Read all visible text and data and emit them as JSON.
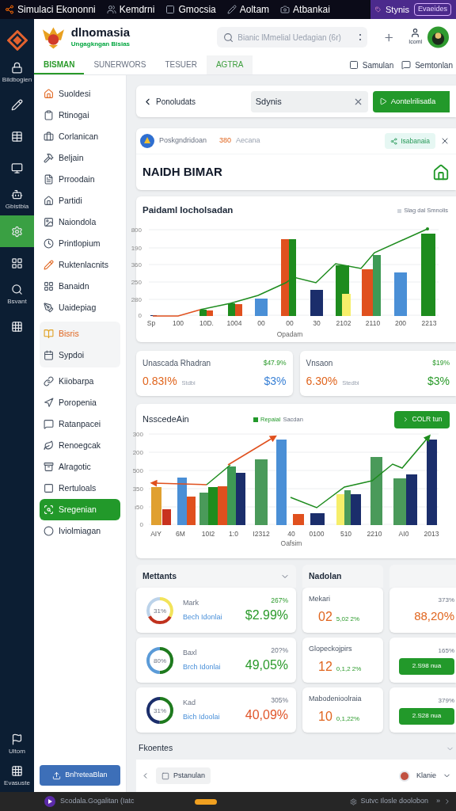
{
  "top_bar": {
    "items": [
      "Simulaci Ekononni",
      "Kemdrni",
      "Gmocsia",
      "Aoltam",
      "Atbankai"
    ],
    "user": "Stynis",
    "button": "Evaeides"
  },
  "rail": {
    "items": [
      {
        "label": "Bildbogien",
        "selected": false
      },
      {
        "selected": false
      },
      {
        "selected": false
      },
      {
        "selected": false
      },
      {
        "label": "Gbistbia",
        "selected": false
      },
      {
        "selected": true
      },
      {
        "selected": false
      },
      {
        "label": "Bsvant",
        "selected": false
      },
      {
        "selected": false
      }
    ],
    "bottom": [
      "Ultom",
      "Evasuste"
    ]
  },
  "header": {
    "title": "dlnomasia",
    "subtitle": "Ungagkngan Bisias",
    "search": {
      "placeholder": "Bianic lMmelial Uedagian (6r)"
    },
    "account": "Icoml"
  },
  "tabs": [
    {
      "label": "BISMAN",
      "selected": true,
      "hover": false
    },
    {
      "label": "SUNERWORS",
      "selected": false,
      "hover": false
    },
    {
      "label": "TESUER",
      "selected": false,
      "hover": false
    },
    {
      "label": "AGTRA",
      "selected": false,
      "hover": true
    }
  ],
  "tab_actions": [
    "Samulan",
    "Semtonlan"
  ],
  "nav": {
    "items": [
      {
        "kind": "item",
        "label": "Suoldesi",
        "selected": false
      },
      {
        "kind": "item",
        "label": "Rtinogai",
        "selected": false
      },
      {
        "kind": "item",
        "label": "Corlanican",
        "selected": false
      },
      {
        "kind": "item",
        "label": "Beljain",
        "selected": false
      },
      {
        "kind": "item",
        "label": "Prroodain",
        "selected": false
      },
      {
        "kind": "item",
        "label": "Partidi",
        "selected": false
      },
      {
        "kind": "item",
        "label": "Naiondola",
        "selected": false
      },
      {
        "kind": "item",
        "label": "Printlopium",
        "selected": false
      },
      {
        "kind": "item",
        "label": "Ruktenlacnits",
        "selected": false
      },
      {
        "kind": "item",
        "label": "Banaidn",
        "selected": false
      },
      {
        "kind": "item",
        "label": "Uaidepiag",
        "selected": false
      },
      {
        "kind": "group",
        "selected": false,
        "children": [
          {
            "label": "Bisris",
            "active": true
          },
          {
            "label": "Sypdoi",
            "active": false
          }
        ]
      },
      {
        "kind": "item",
        "label": "Kiiobarpa",
        "selected": false
      },
      {
        "kind": "item",
        "label": "Poropenia",
        "selected": false
      },
      {
        "kind": "item",
        "label": "Ratanpacei",
        "selected": false
      },
      {
        "kind": "item",
        "label": "Renoegcak",
        "selected": false
      },
      {
        "kind": "item",
        "label": "Alragotic",
        "selected": false
      },
      {
        "kind": "item",
        "label": "Rertuloals",
        "selected": false
      },
      {
        "kind": "item",
        "label": "Sregenian",
        "selected": true
      },
      {
        "kind": "item",
        "label": "Iviolmiagan",
        "selected": false
      }
    ],
    "button": "Bnl'reteaBlan"
  },
  "toolbar": {
    "back": "Ponoludats",
    "filter": {
      "value": "Sdynis"
    },
    "button": "Aontelrilisatla"
  },
  "banner": {
    "name": "Poskgndridoan",
    "count": "380",
    "count_label": "Aecana",
    "chip": "Isabanaia",
    "title": "NAIDH BIMAR"
  },
  "chart1": {
    "title": "Paidaml Iocholsadan",
    "legend": "Slag dal Smnolis",
    "y_labels": [
      "800",
      "190",
      "360",
      "250",
      "280",
      "0"
    ],
    "x_labels": [
      "Sp",
      "100",
      "10D.",
      "1004",
      "00",
      "00",
      "30",
      "2102",
      "2110",
      "200",
      "2213"
    ],
    "xlabel": "Opadam"
  },
  "stats": [
    {
      "title": "Unascada Rhadran",
      "value": "0.83I%",
      "sub": "Stdbi",
      "pct": "$47.9%",
      "amount": "$3%",
      "color": "#3b82d6"
    },
    {
      "title": "Vnsaon",
      "value": "6.30%",
      "sub": "Stedbi",
      "pct": "$19%",
      "amount": "$3%",
      "color": "#2a9a2a"
    }
  ],
  "chart2": {
    "title": "NsscedeAin",
    "legend": [
      "Repaial",
      "Sacdan"
    ],
    "button": "COLR tun",
    "y_labels": [
      "300",
      "200",
      "500",
      "350",
      "ı50",
      "0"
    ],
    "x_labels": [
      "AIY",
      "6M",
      "10I2",
      "1:0",
      "I2312",
      "40",
      "0100",
      "510",
      "2210",
      "AI0",
      "2013"
    ],
    "xlabel": "Oafsim"
  },
  "metrics": {
    "header": "Mettants",
    "rows": [
      {
        "name": "Mark",
        "sub": "Bech Idonlai",
        "pct": "267%",
        "value": "$2.99%",
        "center": "31%",
        "color": "#2a9a2a",
        "kind": "tri"
      },
      {
        "name": "Baxl",
        "sub": "Brch Idonlai",
        "pct": "20?%",
        "value": "49,05%",
        "center": "80%",
        "color": "#2a9a2a",
        "kind": "blue"
      },
      {
        "name": "Kad",
        "sub": "Bich Idoolai",
        "pct": "305%",
        "value": "40,09%",
        "center": "31%",
        "color": "#e0552a",
        "kind": "navy"
      }
    ]
  },
  "nadolan": {
    "header": "Nadolan",
    "rows": [
      {
        "name": "Mekari",
        "value": "02",
        "sub": "5,02 2%"
      },
      {
        "name": "Glopeckojpirs",
        "value": "12",
        "sub": "0,1,2 2%"
      },
      {
        "name": "Mabodenioolraia",
        "value": "10",
        "sub": "0,1,22%"
      }
    ]
  },
  "column3": {
    "rows": [
      {
        "kind": "value",
        "pct": "373%",
        "value": "88,20%"
      },
      {
        "kind": "button",
        "pct": "165%",
        "value": "2.S98 nua"
      },
      {
        "kind": "button",
        "pct": "379%",
        "value": "2.S28 nua"
      }
    ]
  },
  "footer": {
    "title": "Fkoentes",
    "chip": "Pstanulan",
    "user": "Klanie"
  },
  "status_bar": {
    "left": "Scodala.Gogalitan (Iatc",
    "right": "Sutvc Ilosle doolobon",
    "arrows": "»"
  }
}
